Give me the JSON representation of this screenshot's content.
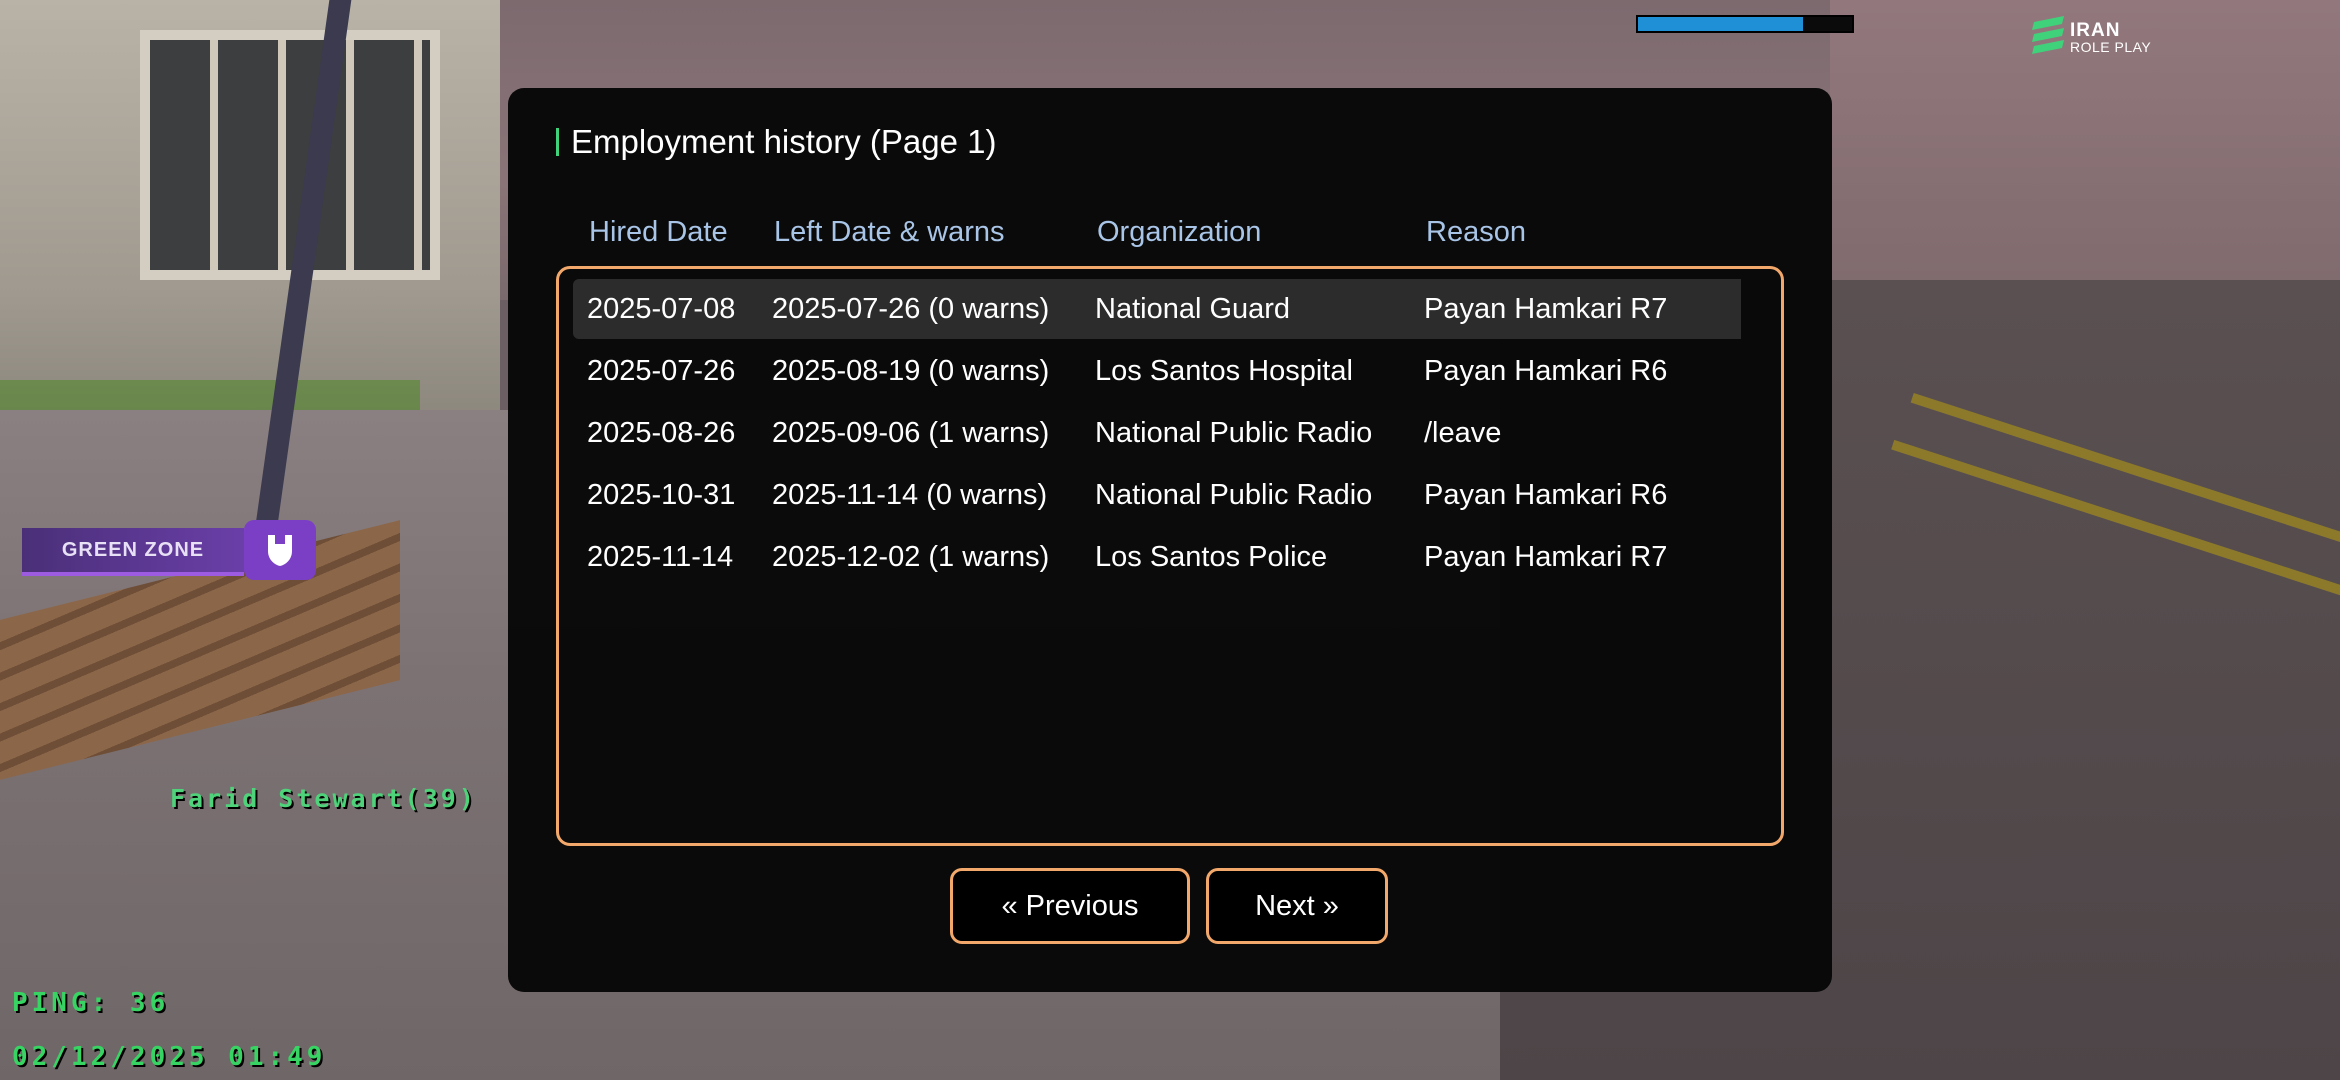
{
  "hud": {
    "health_fill": 0.77,
    "health_color": "#1f8fd6",
    "logo_line1": "IRAN",
    "logo_line2": "ROLE PLAY",
    "zone_label": "GREEN ZONE",
    "zone_icon": "shield-icon",
    "player_name": "Farid Stewart(39)",
    "ping": "PING: 36",
    "datetime": "02/12/2025 01:49"
  },
  "dialog": {
    "title": "Employment history (Page 1)",
    "columns": [
      "Hired Date",
      "Left Date & warns",
      "Organization",
      "Reason"
    ],
    "rows": [
      {
        "hired": "2025-07-08",
        "left": "2025-07-26 (0 warns)",
        "org": "National Guard",
        "reason": "Payan Hamkari R7",
        "selected": true
      },
      {
        "hired": "2025-07-26",
        "left": "2025-08-19 (0 warns)",
        "org": "Los Santos Hospital",
        "reason": "Payan Hamkari R6",
        "selected": false
      },
      {
        "hired": "2025-08-26",
        "left": "2025-09-06 (1 warns)",
        "org": "National Public Radio",
        "reason": "/leave",
        "selected": false
      },
      {
        "hired": "2025-10-31",
        "left": "2025-11-14 (0 warns)",
        "org": "National Public Radio",
        "reason": "Payan Hamkari R6",
        "selected": false
      },
      {
        "hired": "2025-11-14",
        "left": "2025-12-02 (1 warns)",
        "org": "Los Santos Police",
        "reason": "Payan Hamkari R7",
        "selected": false
      }
    ],
    "prev_label": "« Previous",
    "next_label": "Next »",
    "accent_color": "#f2a86b",
    "header_color": "#a8c4e6"
  }
}
